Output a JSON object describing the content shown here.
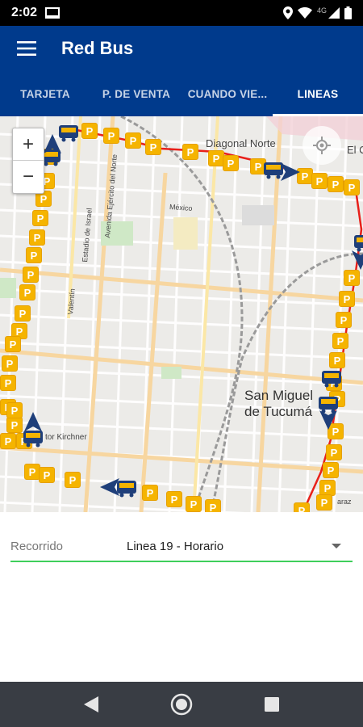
{
  "status_bar": {
    "time": "2:02",
    "network_type": "4G"
  },
  "app_bar": {
    "title": "Red Bus",
    "menu_icon": "hamburger-menu-icon"
  },
  "tabs": [
    {
      "label": "TARJETA",
      "active": false
    },
    {
      "label": "P. DE VENTA",
      "active": false
    },
    {
      "label": "CUANDO VIE...",
      "active": false
    },
    {
      "label": "LINEAS",
      "active": true
    }
  ],
  "map": {
    "zoom_in_label": "+",
    "zoom_out_label": "−",
    "labels": {
      "diagonal_norte": "Diagonal Norte",
      "el_c": "El C",
      "mexico": "México",
      "avenida_ejercito": "Avenida Ejército del Norte",
      "estadio": "Estadio de Israel",
      "valentin": "Valentín",
      "kirchner": "tor Kirchner",
      "city_line1": "San Miguel",
      "city_line2": "de Tucumá",
      "parking_letter": "P",
      "right_partial": "araz"
    },
    "route_color": "#e8201a",
    "parking_color": "#f5b400",
    "bus_color": "#1f3f7a"
  },
  "form": {
    "label": "Recorrido",
    "value": "Linea 19 - Horario",
    "underline_color": "#3fcf5b"
  },
  "nav_bar": {
    "back_icon": "back-triangle-icon",
    "home_icon": "home-circle-icon",
    "recents_icon": "recents-square-icon"
  }
}
